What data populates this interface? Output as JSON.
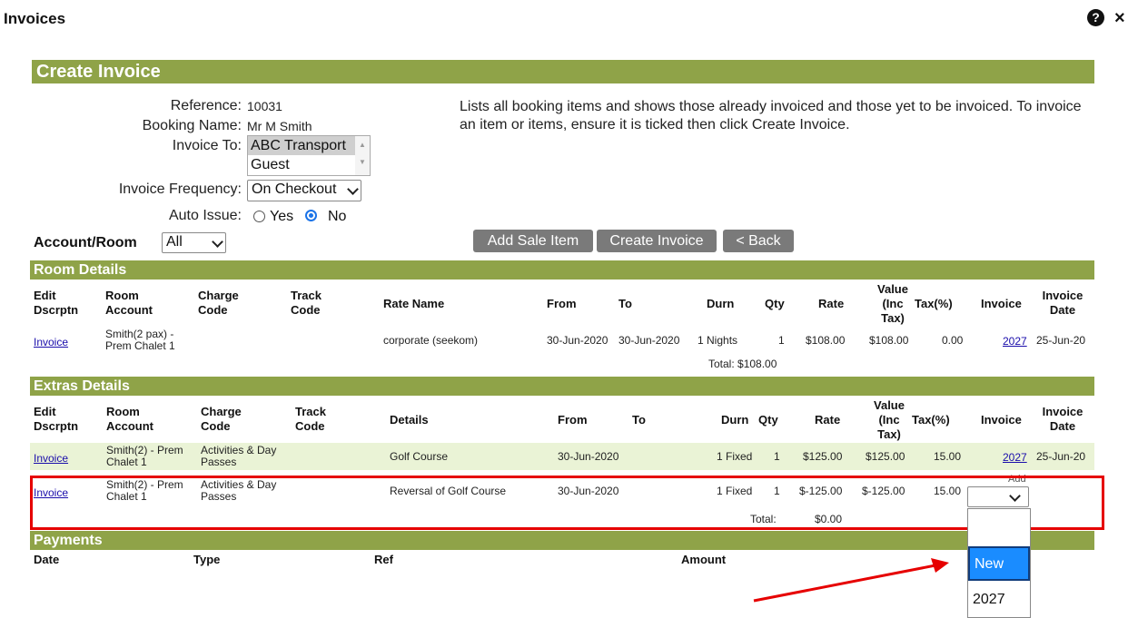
{
  "window": {
    "title": "Invoices",
    "help_icon": "question-circle-icon",
    "close_icon": "close-icon"
  },
  "banner": "Create Invoice",
  "form": {
    "reference_label": "Reference:",
    "reference": "10031",
    "booking_name_label": "Booking Name:",
    "booking_name": "Mr M Smith",
    "invoice_to_label": "Invoice To:",
    "invoice_to_options": [
      "ABC Transport",
      "Guest"
    ],
    "frequency_label": "Invoice Frequency:",
    "frequency": "On Checkout",
    "auto_issue_label": "Auto Issue:",
    "auto_yes": "Yes",
    "auto_no": "No",
    "account_room_label": "Account/Room",
    "account_room": "All"
  },
  "description": "Lists all booking items and shows those already invoiced and those yet to be invoiced. To invoice an item or items, ensure it is ticked then click Create Invoice.",
  "buttons": {
    "add_sale": "Add Sale Item",
    "create": "Create Invoice",
    "back": "< Back"
  },
  "room": {
    "title": "Room Details",
    "headers": {
      "edit": "Edit Dscrptn",
      "room": "Room Account",
      "charge": "Charge Code",
      "track": "Track Code",
      "rate_name": "Rate Name",
      "from": "From",
      "to": "To",
      "durn": "Durn",
      "qty": "Qty",
      "rate": "Rate",
      "value": "Value (Inc Tax)",
      "tax": "Tax(%)",
      "invoice": "Invoice",
      "invoice_date": "Invoice Date"
    },
    "row": {
      "edit": "Invoice",
      "room": "Smith(2 pax) - Prem Chalet 1",
      "rate_name": "corporate (seekom)",
      "from": "30-Jun-2020",
      "to": "30-Jun-2020",
      "durn": "1 Nights",
      "qty": "1",
      "rate": "$108.00",
      "value": "$108.00",
      "tax": "0.00",
      "invoice": "2027",
      "invoice_date": "25-Jun-20"
    },
    "total": "Total: $108.00"
  },
  "extras": {
    "title": "Extras Details",
    "headers": {
      "edit": "Edit Dscrptn",
      "room": "Room Account",
      "charge": "Charge Code",
      "track": "Track Code",
      "details": "Details",
      "from": "From",
      "to": "To",
      "durn": "Durn",
      "qty": "Qty",
      "rate": "Rate",
      "value": "Value (Inc Tax)",
      "tax": "Tax(%)",
      "invoice": "Invoice",
      "invoice_date": "Invoice Date"
    },
    "rows": [
      {
        "edit": "Invoice",
        "room": "Smith(2) - Prem Chalet 1",
        "charge": "Activities & Day Passes",
        "details": "Golf Course",
        "from": "30-Jun-2020",
        "durn": "1 Fixed",
        "qty": "1",
        "rate": "$125.00",
        "value": "$125.00",
        "tax": "15.00",
        "invoice": "2027",
        "invoice_date": "25-Jun-20"
      },
      {
        "edit": "Invoice",
        "room": "Smith(2) - Prem Chalet 1",
        "charge": "Activities & Day Passes",
        "details": "Reversal of Golf Course",
        "from": "30-Jun-2020",
        "durn": "1 Fixed",
        "qty": "1",
        "rate": "$-125.00",
        "value": "$-125.00",
        "tax": "15.00",
        "invoice_hint": "Add"
      }
    ],
    "total_label": "Total:",
    "total_value": "$0.00"
  },
  "payments": {
    "title": "Payments",
    "headers": {
      "date": "Date",
      "type": "Type",
      "ref": "Ref",
      "amount": "Amount"
    }
  },
  "dropdown": {
    "options": [
      "",
      "New",
      "2027"
    ],
    "selected": "New"
  },
  "colors": {
    "section": "#8fa348",
    "highlight_row": "#eaf3d6",
    "annotation": "#e60000",
    "selected_option": "#1a8cff"
  }
}
